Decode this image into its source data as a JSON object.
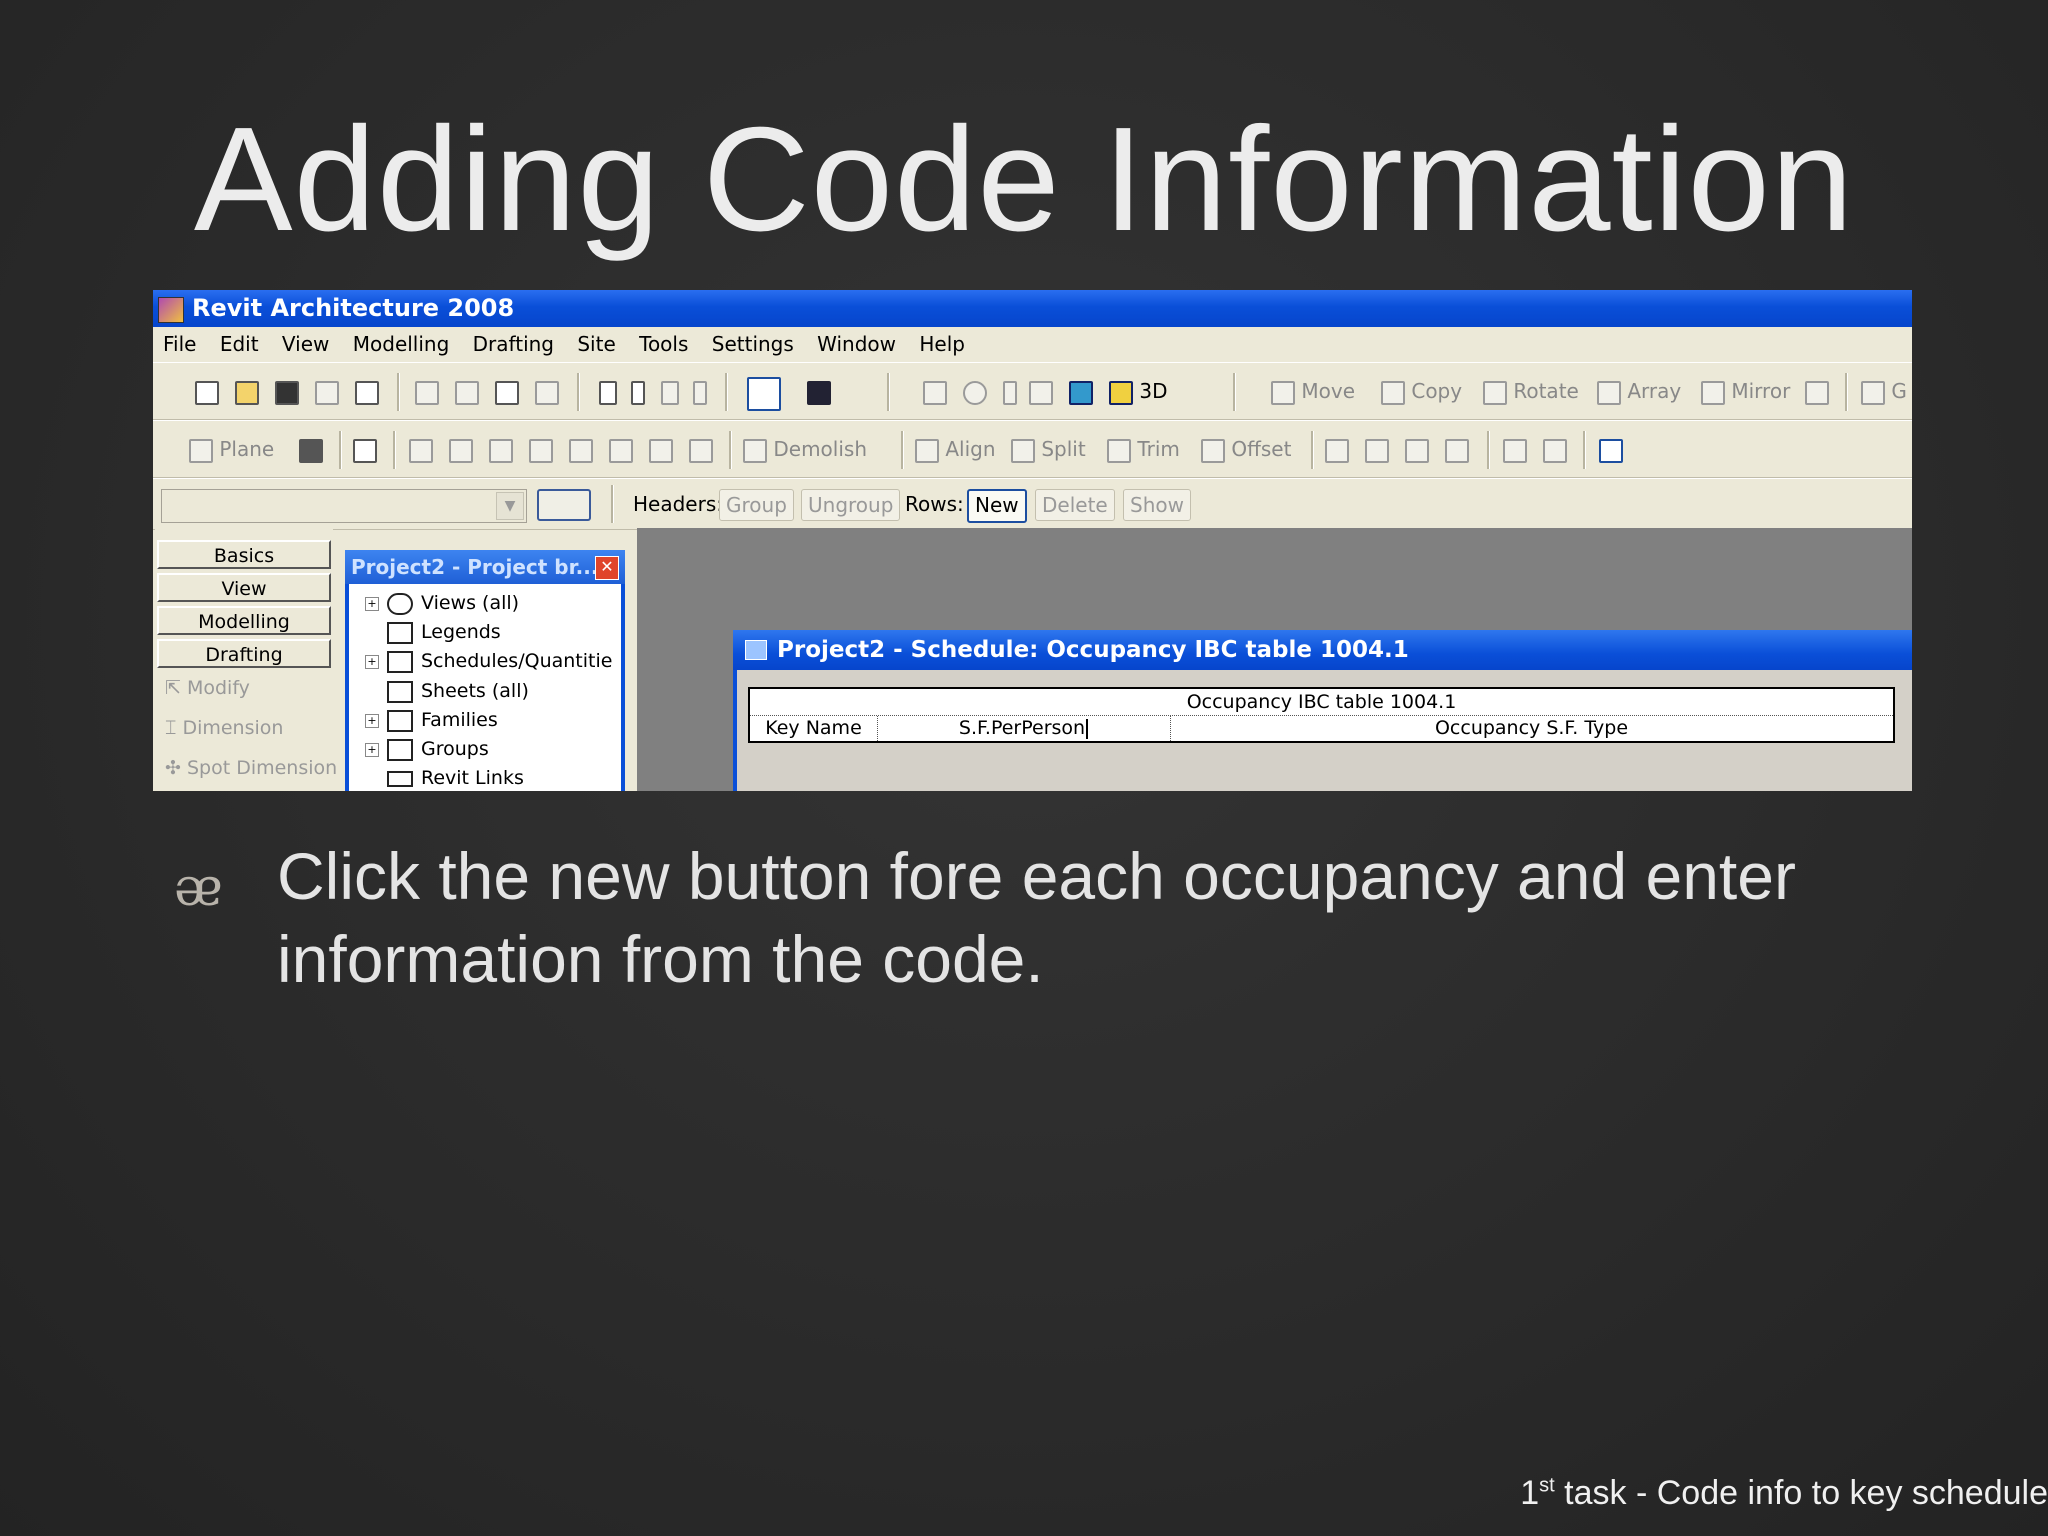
{
  "slide": {
    "title": "Adding Code Information",
    "bullet": "Click the new button fore each occupancy and enter information from the code.",
    "footer_ordinal": "1",
    "footer_suffix": "st",
    "footer_text": " task - Code info to key schedule"
  },
  "app": {
    "title": "Revit Architecture 2008",
    "menu": [
      "File",
      "Edit",
      "View",
      "Modelling",
      "Drafting",
      "Site",
      "Tools",
      "Settings",
      "Window",
      "Help"
    ],
    "toolbar1": {
      "view3d": "3D",
      "move": "Move",
      "copy": "Copy",
      "rotate": "Rotate",
      "array": "Array",
      "mirror": "Mirror",
      "truncated": "G"
    },
    "toolbar2": {
      "plane": "Plane",
      "demolish": "Demolish",
      "align": "Align",
      "split": "Split",
      "trim": "Trim",
      "offset": "Offset"
    },
    "options_bar": {
      "headers_label": "Headers:",
      "group": "Group",
      "ungroup": "Ungroup",
      "rows_label": "Rows:",
      "new": "New",
      "delete": "Delete",
      "show": "Show"
    },
    "design_bar": {
      "tabs": [
        "Basics",
        "View",
        "Modelling",
        "Drafting"
      ],
      "tools": [
        "Modify",
        "Dimension",
        "Spot Dimension"
      ]
    },
    "project_browser": {
      "title": "Project2 - Project br...",
      "items": [
        "Views (all)",
        "Legends",
        "Schedules/Quantitie",
        "Sheets (all)",
        "Families",
        "Groups",
        "Revit Links"
      ]
    },
    "schedule": {
      "window_title": "Project2 - Schedule: Occupancy IBC table 1004.1",
      "caption": "Occupancy IBC table 1004.1",
      "columns": [
        "Key Name",
        "S.F.PerPerson",
        "Occupancy S.F. Type"
      ]
    }
  }
}
